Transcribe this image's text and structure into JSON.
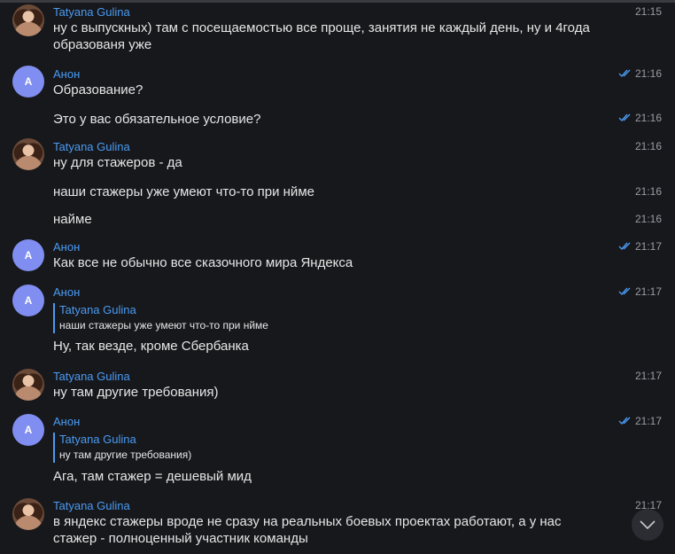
{
  "messages": [
    {
      "author": "Tatyana Gulina",
      "avatar": "photo",
      "time": "21:15",
      "text": "ну с выпускных) там с посещаемостью все проще, занятия не каждый день, ну и 4года образованя уже"
    },
    {
      "author": "Анон",
      "avatar_letter": "А",
      "time": "21:16",
      "text": "Образование?"
    },
    {
      "time": "21:16",
      "text": "Это у вас обязательное условие?"
    },
    {
      "author": "Tatyana Gulina",
      "avatar": "photo",
      "time": "21:16",
      "text": "ну для стажеров - да"
    },
    {
      "time": "21:16",
      "text": "наши стажеры уже умеют что-то при нйме"
    },
    {
      "time": "21:16",
      "text": "найме"
    },
    {
      "author": "Анон",
      "avatar_letter": "А",
      "time": "21:17",
      "text": "Как все не обычно все сказочного мира Яндекса"
    },
    {
      "author": "Анон",
      "avatar_letter": "А",
      "time": "21:17",
      "reply_author": "Tatyana Gulina",
      "reply_text": "наши стажеры уже умеют что-то при нйме",
      "text": "Ну, так везде, кроме Сбербанка"
    },
    {
      "author": "Tatyana Gulina",
      "avatar": "photo",
      "time": "21:17",
      "text": "ну там другие требования)"
    },
    {
      "author": "Анон",
      "avatar_letter": "А",
      "time": "21:17",
      "reply_author": "Tatyana Gulina",
      "reply_text": "ну там другие требования)",
      "text": "Ага, там стажер = дешевый мид"
    },
    {
      "author": "Tatyana Gulina",
      "avatar": "photo",
      "time": "21:17",
      "text": "в яндекс стажеры вроде не сразу на реальных боевых проектах работают, а у нас стажер - полноценный участник команды"
    }
  ],
  "colors": {
    "background": "#17181c",
    "accent": "#4a9bf2",
    "avatar_letter_bg": "#7f8ef0"
  },
  "icons": {
    "read_receipt": "double-check-icon",
    "scroll_down": "chevron-down-icon"
  }
}
